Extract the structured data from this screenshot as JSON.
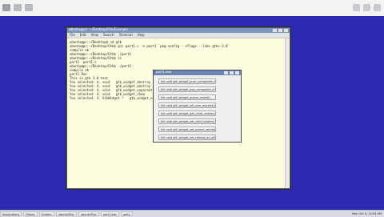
{
  "terminal": {
    "title": "ubuntu@pc: ~/Desktop/Gtk/Example",
    "menu": [
      "File",
      "Edit",
      "View",
      "Search",
      "Terminal",
      "Help"
    ],
    "lines": [
      "ubuntu@pc:~/Desktop$ cd gtk",
      "ubuntu@pc:~/Desktop/Gtk$ gcc part1.c -o part1 `pkg-config --cflags --libs gtk+-3.0`",
      "compile ok",
      "ubuntu@pc:~/Desktop/Gtk$ ./part1",
      "ubuntu@pc:~/Desktop/Gtk$ ls",
      "part1  part1.c",
      "ubuntu@pc:~/Desktop/Gtk$ ./part1",
      "compile ok",
      "part1 Run",
      "This is gtk 3.0 test",
      "You selected: 4. void   gtk_widget_destroy",
      "You selected: 4. void   gtk_widget_destroy",
      "You selected: 4. void   gtk_widget_unparent",
      "You selected: 4. void   gtk_widget_show",
      "You selected: 4. GtkWidget *   gtk_widget_new"
    ]
  },
  "dialog": {
    "title": "part1.exe",
    "buttons": [
      "Init void   gtk_widget_push_composite_child()",
      "Init void   gtk_widget_pop_composite_child()",
      "Init void   gtk_widget_queue_resize()",
      "Init void   gtk_widget_set_size_request()",
      "Init void   gtk_widget_get_child_visible()",
      "Init void   gtk_widget_set_child_visible()",
      "Init void   gtk_widget_set_parent_window()",
      "Init void   gtk_widget_set_redraw_on_allocate()",
      "Init void   gtk_widget_set_composite_name()",
      "Init gboolean   gtk_widget_activate()"
    ]
  },
  "taskbar": {
    "items": [
      "Applications",
      "Places",
      "System",
      "ubuntu@pc",
      "ubuntu@pc",
      "part1.exe",
      "part1"
    ],
    "clock": "Mon Oct 4, 12:04 AM"
  }
}
